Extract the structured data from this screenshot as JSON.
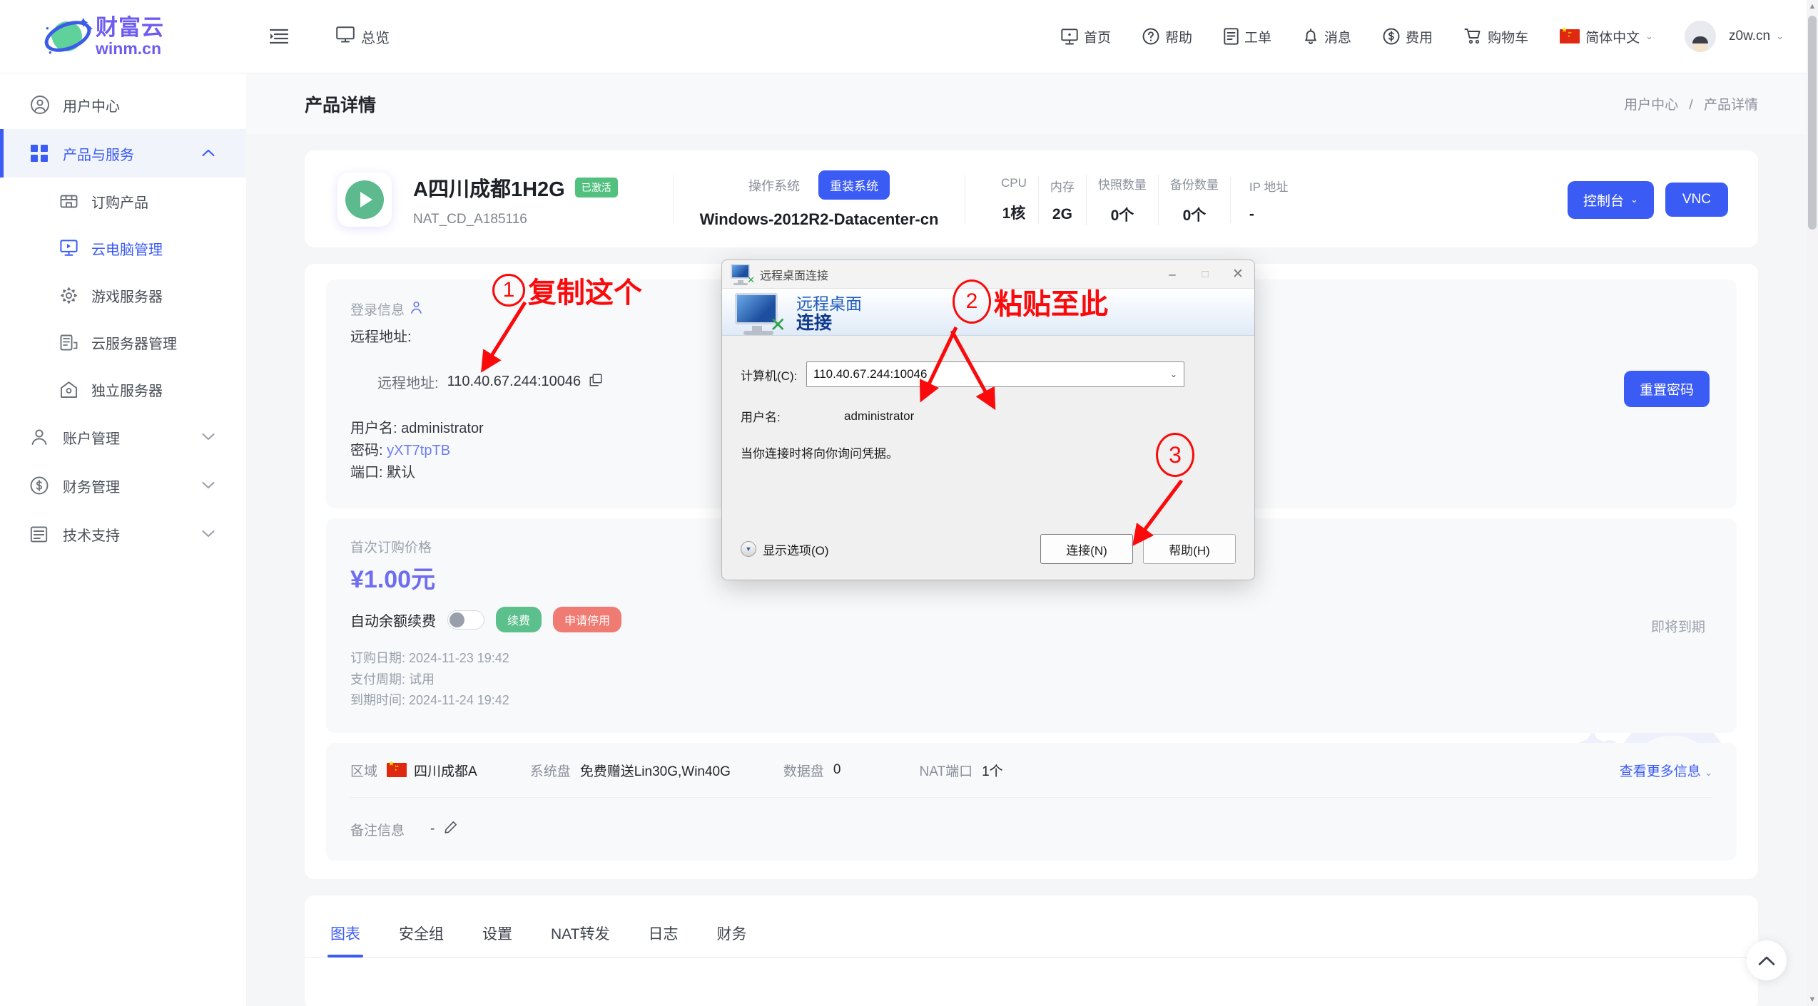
{
  "brand": {
    "cn": "财富云",
    "en": "winm.cn"
  },
  "topbar": {
    "overview_label": "总览",
    "nav": [
      {
        "label": "首页",
        "icon": "home-icon"
      },
      {
        "label": "帮助",
        "icon": "help-icon"
      },
      {
        "label": "工单",
        "icon": "ticket-icon"
      },
      {
        "label": "消息",
        "icon": "bell-icon"
      },
      {
        "label": "费用",
        "icon": "dollar-icon"
      },
      {
        "label": "购物车",
        "icon": "cart-icon"
      }
    ],
    "language": "简体中文",
    "user": "z0w.cn"
  },
  "sidebar": {
    "items": [
      {
        "label": "用户中心",
        "icon": "user-circle-icon"
      },
      {
        "label": "产品与服务",
        "icon": "grid-icon",
        "active": true,
        "arrow": "chevron-up-icon"
      },
      {
        "label": "账户管理",
        "icon": "person-icon",
        "arrow": "chevron-down-icon"
      },
      {
        "label": "财务管理",
        "icon": "dollar-circle-icon",
        "arrow": "chevron-down-icon"
      },
      {
        "label": "技术支持",
        "icon": "doc-lines-icon",
        "arrow": "chevron-down-icon"
      }
    ],
    "sub_items": [
      {
        "label": "订购产品",
        "icon": "store-icon"
      },
      {
        "label": "云电脑管理",
        "icon": "monitor-play-icon",
        "selected": true
      },
      {
        "label": "游戏服务器",
        "icon": "gear-icon"
      },
      {
        "label": "云服务器管理",
        "icon": "server-doc-icon"
      },
      {
        "label": "独立服务器",
        "icon": "home-server-icon"
      }
    ]
  },
  "page": {
    "title": "产品详情",
    "breadcrumb": {
      "parent": "用户中心",
      "sep": "/",
      "current": "产品详情"
    }
  },
  "product": {
    "name": "A四川成都1H2G",
    "status_badge": "已激活",
    "id": "NAT_CD_A185116",
    "os_label": "操作系统",
    "reinstall_btn": "重装系统",
    "os_name": "Windows-2012R2-Datacenter-cn",
    "specs": [
      {
        "label": "CPU",
        "value": "1核"
      },
      {
        "label": "内存",
        "value": "2G"
      },
      {
        "label": "快照数量",
        "value": "0个"
      },
      {
        "label": "备份数量",
        "value": "0个"
      },
      {
        "label": "IP 地址",
        "value": "-"
      }
    ],
    "console_btn": "控制台",
    "vnc_btn": "VNC"
  },
  "login_panel": {
    "title": "登录信息",
    "remote_label_top": "远程地址:",
    "remote_label": "远程地址:",
    "remote_value": "110.40.67.244:10046",
    "copy_icon": "copy-icon",
    "username_label": "用户名:",
    "username_value": "administrator",
    "password_label": "密码:",
    "password_value": "yXT7tpTB",
    "port_label": "端口:",
    "port_value": "默认",
    "reset_password_btn": "重置密码"
  },
  "price_panel": {
    "label": "首次订购价格",
    "value": "¥1.00元",
    "auto_renew_label": "自动余额续费",
    "auto_renew_on": false,
    "renew_btn": "续费",
    "suspend_btn": "申请停用",
    "order_date_label": "订购日期:",
    "order_date_value": "2024-11-23 19:42",
    "pay_cycle_label": "支付周期:",
    "pay_cycle_value": "试用",
    "expire_label": "到期时间:",
    "expire_value": "2024-11-24 19:42",
    "expire_note": "即将到期"
  },
  "info_panel": {
    "region_label": "区域",
    "region_value": "四川成都A",
    "sysdisk_label": "系统盘",
    "sysdisk_value": "免费赠送Lin30G,Win40G",
    "datadisk_label": "数据盘",
    "datadisk_value": "0",
    "natport_label": "NAT端口",
    "natport_value": "1个",
    "more_label": "查看更多信息",
    "note_label": "备注信息",
    "note_value": "-",
    "edit_icon": "pencil-icon"
  },
  "tabs": [
    {
      "label": "图表",
      "active": true
    },
    {
      "label": "安全组",
      "active": false
    },
    {
      "label": "设置",
      "active": false
    },
    {
      "label": "NAT转发",
      "active": false
    },
    {
      "label": "日志",
      "active": false
    },
    {
      "label": "财务",
      "active": false
    }
  ],
  "rdp_dialog": {
    "window_title": "远程桌面连接",
    "minimize": "–",
    "maximize": "□",
    "close": "✕",
    "banner_line1": "远程桌面",
    "banner_line2": "连接",
    "computer_label": "计算机(C):",
    "computer_value": "110.40.67.244:10046",
    "username_label": "用户名:",
    "username_value": "administrator",
    "hint": "当你连接时将向你询问凭据。",
    "show_options": "显示选项(O)",
    "connect_btn": "连接(N)",
    "help_btn": "帮助(H)"
  },
  "annotations": [
    {
      "num": "1",
      "text": "复制这个"
    },
    {
      "num": "2",
      "text": "粘贴至此"
    },
    {
      "num": "3",
      "text": ""
    }
  ],
  "colors": {
    "accent": "#3b5bf5",
    "brand_purple": "#6e5cf0",
    "green": "#52c07e",
    "red": "#ef7b72",
    "annotation_red": "#fa0a0a"
  }
}
